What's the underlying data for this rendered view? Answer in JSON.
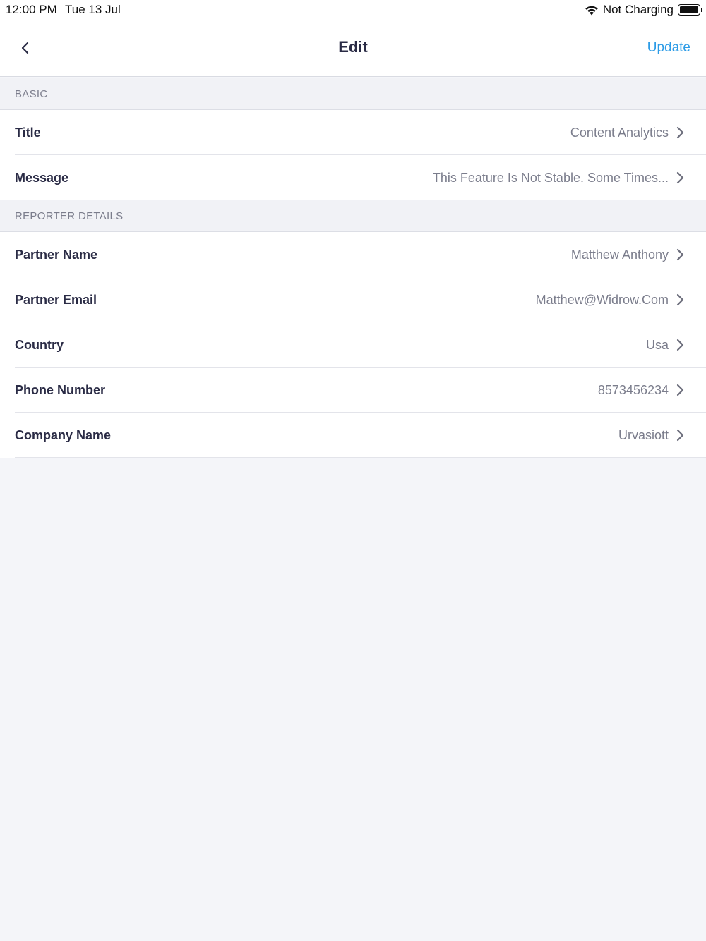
{
  "status_bar": {
    "time": "12:00 PM",
    "date": "Tue 13 Jul",
    "charging": "Not Charging",
    "wifi_icon": "wifi-icon",
    "battery_icon": "battery-icon"
  },
  "nav": {
    "title": "Edit",
    "update_label": "Update",
    "back_icon": "chevron-left-icon",
    "accent_color": "#2c9be6"
  },
  "sections": {
    "basic": {
      "header": "BASIC",
      "rows": [
        {
          "label": "Title",
          "value": "Content Analytics"
        },
        {
          "label": "Message",
          "value": "This Feature Is Not Stable. Some Times..."
        }
      ]
    },
    "reporter": {
      "header": "REPORTER DETAILS",
      "rows": [
        {
          "label": "Partner Name",
          "value": "Matthew Anthony"
        },
        {
          "label": "Partner Email",
          "value": "Matthew@Widrow.Com"
        },
        {
          "label": "Country",
          "value": "Usa"
        },
        {
          "label": "Phone Number",
          "value": "8573456234"
        },
        {
          "label": "Company Name",
          "value": "Urvasiott"
        }
      ]
    }
  },
  "row_icon": "chevron-right-icon"
}
